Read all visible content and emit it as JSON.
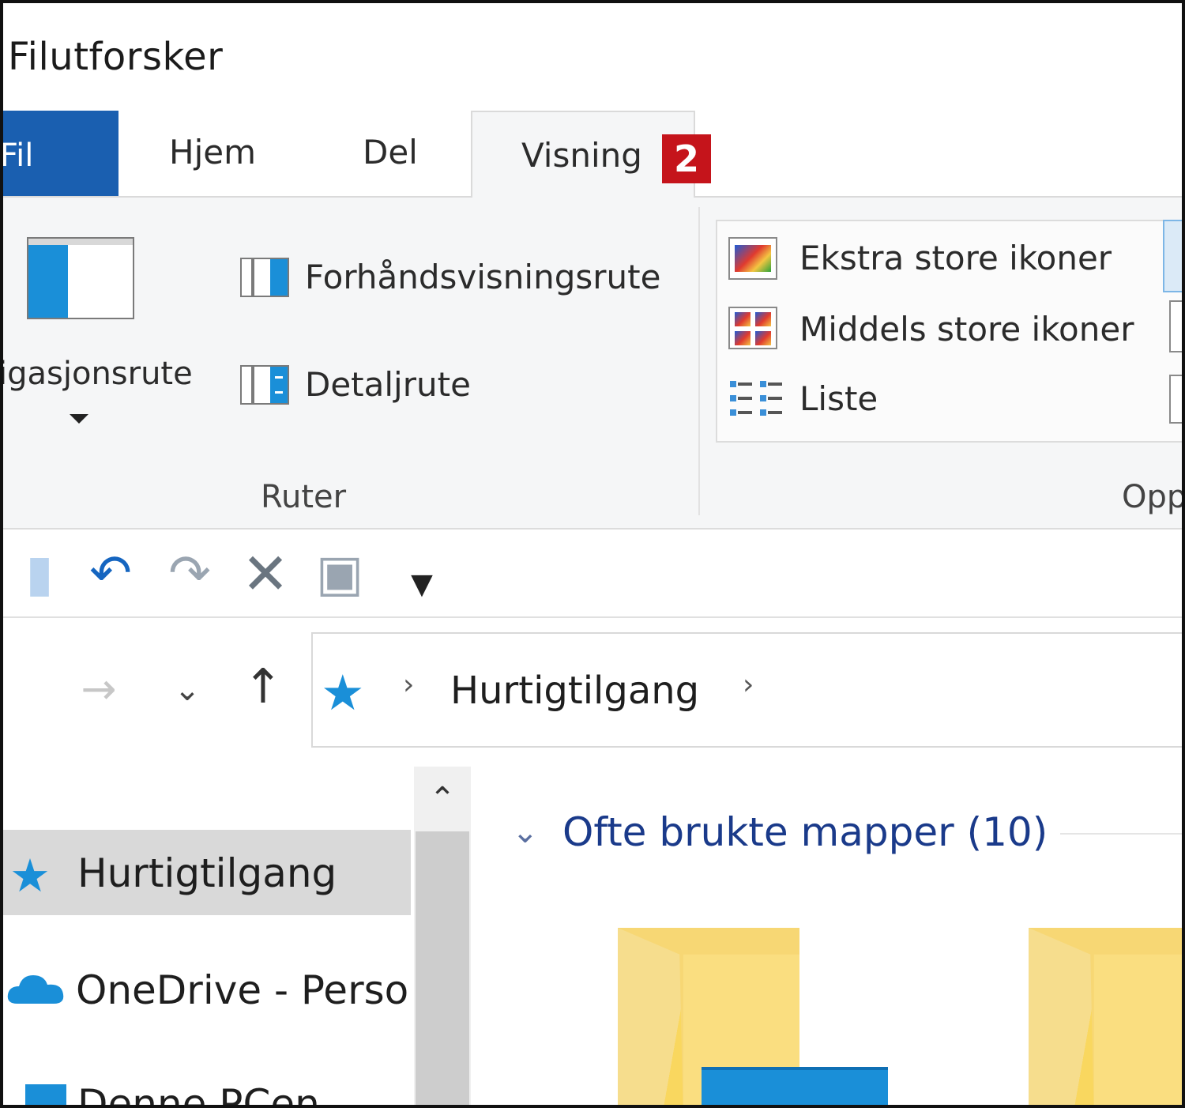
{
  "window": {
    "title": "Filutforsker"
  },
  "ribbon_tabs": {
    "file": "Fil",
    "home": "Hjem",
    "share": "Del",
    "view": "Visning",
    "step_badge": "2"
  },
  "panes_group": {
    "navigation_pane_label": "igasjonsrute",
    "preview_pane_label": "Forhåndsvisningsrute",
    "details_pane_label": "Detaljrute",
    "group_label": "Ruter"
  },
  "layout_group": {
    "extra_large_icons": "Ekstra store ikoner",
    "medium_icons": "Middels store ikoner",
    "list": "Liste",
    "group_label": "Opp"
  },
  "quick_access_toolbar": {
    "items": [
      "properties-icon",
      "undo-icon",
      "redo-icon",
      "delete-icon",
      "rename-icon",
      "customize-dropdown-icon"
    ]
  },
  "navigation": {
    "address_path": "Hurtigtilgang"
  },
  "nav_tree": {
    "quick_access": "Hurtigtilgang",
    "onedrive": "OneDrive - Personlig",
    "this_pc": "Denne PCen"
  },
  "content": {
    "group_header": "Ofte brukte mapper (10)"
  },
  "colors": {
    "file_tab": "#1a5fb0",
    "badge": "#c5141b",
    "accent_blue": "#1a8fd8",
    "group_header": "#1a3a8a",
    "folder_yellow": "#f9d75f"
  }
}
